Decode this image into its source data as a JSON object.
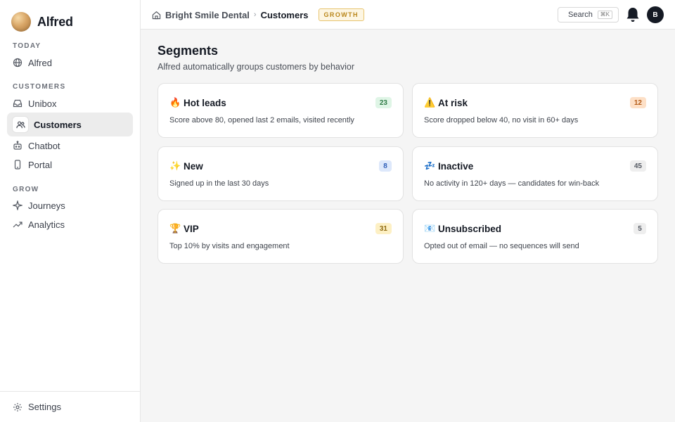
{
  "app": {
    "name": "Alfred"
  },
  "sidebar": {
    "sections": [
      {
        "label": "TODAY"
      },
      {
        "label": "CUSTOMERS"
      },
      {
        "label": "GROW"
      }
    ],
    "items": [
      {
        "label": "Alfred",
        "icon": "globe-icon"
      },
      {
        "label": "Unibox",
        "icon": "inbox-icon"
      },
      {
        "label": "Customers",
        "icon": "users-icon",
        "active": true
      },
      {
        "label": "Chatbot",
        "icon": "bot-icon"
      },
      {
        "label": "Portal",
        "icon": "phone-icon"
      },
      {
        "label": "Journeys",
        "icon": "sparkle-icon"
      },
      {
        "label": "Analytics",
        "icon": "trend-icon"
      }
    ],
    "footer": {
      "label": "Settings",
      "icon": "gear-icon"
    }
  },
  "topbar": {
    "breadcrumb_home": "Bright Smile Dental",
    "breadcrumb_sep": "›",
    "breadcrumb_current": "Customers",
    "plan_badge": "GROWTH",
    "search_label": "Search",
    "search_kbd": "⌘K",
    "avatar_initial": "B"
  },
  "main": {
    "title": "Segments",
    "subtitle": "Alfred automatically groups customers by behavior",
    "segments": [
      {
        "emoji": "🔥",
        "name": "Hot leads",
        "count": "23",
        "color": "green",
        "desc": "Score above 80, opened last 2 emails, visited recently"
      },
      {
        "emoji": "⚠️",
        "name": "At risk",
        "count": "12",
        "color": "orange",
        "desc": "Score dropped below 40, no visit in 60+ days"
      },
      {
        "emoji": "✨",
        "name": "New",
        "count": "8",
        "color": "blue",
        "desc": "Signed up in the last 30 days"
      },
      {
        "emoji": "💤",
        "name": "Inactive",
        "count": "45",
        "color": "gray",
        "desc": "No activity in 120+ days — candidates for win-back"
      },
      {
        "emoji": "🏆",
        "name": "VIP",
        "count": "31",
        "color": "yellow",
        "desc": "Top 10% by visits and engagement"
      },
      {
        "emoji": "📧",
        "name": "Unsubscribed",
        "count": "5",
        "color": "gray",
        "desc": "Opted out of email — no sequences will send"
      }
    ]
  },
  "colors": {
    "accent": "#e39a4a",
    "avatar": "#151a24",
    "badge_border": "#e8c46e"
  }
}
